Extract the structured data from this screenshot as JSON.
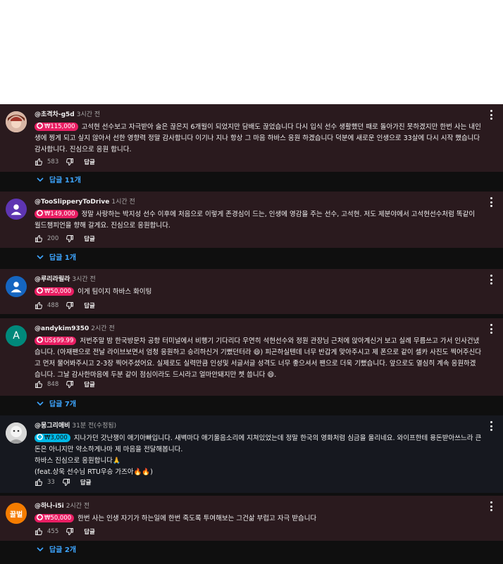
{
  "reply_label": "답글",
  "comments": [
    {
      "author": "@초격차-g5d",
      "time": "3시간 전",
      "amount": "₩115,000",
      "text": "고석현 선수보고 자극받아 술은 끊은지 6개월이 되었지만 담배도 끊었습니다 다시 입식 선수 생활했던 때로 돌아가진 못하겠지만 한번 사는 내인생에 찡게 되고 싶지 않아서 선한 영향력 정말 감사합니다 이기나 지나 항상 그 마음 하바스 응원 하겠습니다 덕분에 새로운 인생으로 33살에 다시 시작 했습니다 감사합니다. 진심으로 응원 합니다.",
      "likes": "583",
      "replies": "답글 11개"
    },
    {
      "author": "@TooSlipperyToDrive",
      "time": "1시간 전",
      "amount": "₩149,000",
      "text": "정말 사랑하는 박지성 선수 이후에 처음으로 이렇게 존경심이 드는, 인생에 영감을 주는 선수, 고석현. 저도 제분야에서 고석현선수처럼 똑같이 월드챔피언을 향해 갈게요. 진심으로 응원합니다.",
      "likes": "200",
      "replies": "답글 1개"
    },
    {
      "author": "@루리라릴라",
      "time": "3시간 전",
      "amount": "₩50,000",
      "text": "이게 팀이지 하바스 화이팅",
      "likes": "488",
      "replies": ""
    },
    {
      "author": "@andykim9350",
      "time": "2시간 전",
      "amount": "US$99.99",
      "avatar_letter": "A",
      "text": "저번주말 밤 한국방문차 공항 터미널에서 비행기 기다리다 우연히 석현선수와 정원 관장님 근처에 앉아계신거 보고 실례 무릅쓰고 가서 인사건냈습니다. (아재팬으로 전날 라이브보면서 엄청 응원하고 승리하신거 기뻤던터라 😄) 피곤하실텐데 너무 반갑게 맞아주시고 제 폰으로 같이 셀카 사진도 찍어주신다고 먼저 물어봐주시고 2-3장 찍어주셨어요. 실제로도 실력만큼 인성및 서글서글 성격도 너무 좋으셔서 팬으로 더욱 기뻤습니다. 앞으로도 열심히 계속 응원하겠습니다. 그날 감사한마음에 두분 같이 점심이라도 드시라고 얼마안돼지만 쳇 씁니다 😄.",
      "likes": "848",
      "replies": "답글 7개"
    },
    {
      "author": "@몽그리애비",
      "time": "31분 전(수정됨)",
      "amount": "₩3,000",
      "text": "지나가던 갓난쟁이 애기아빠입니다. 새벽마다 애기울음소리에 지쳐있었는데 정말 한국의 영화처럼 심금을 울리네요. 와이프한테 용돈받아쓰느라 큰돈은 아니지만 약소하게나마 제 마음을 전달해봅니다.\n하바스 진심으로 응원합니다🙏\n(feat.상욱 선수님 RTU우승 가즈아🔥🔥)",
      "likes": "33",
      "replies": ""
    },
    {
      "author": "@하나-i5i",
      "time": "2시간 전",
      "amount": "₩50,000",
      "avatar_letter": "꿀벌",
      "text": "한번 사는 인생 자기가 하는일에 한번 죽도록 투여해보는 그건삶 부럽고 자극 받습니다",
      "likes": "455",
      "replies": "답글 2개"
    }
  ]
}
